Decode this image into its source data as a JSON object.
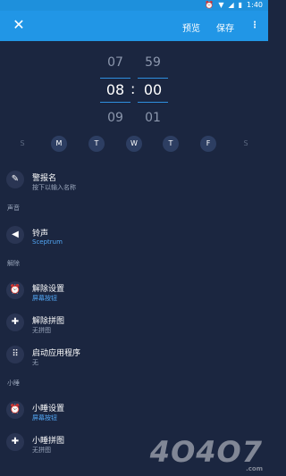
{
  "status": {
    "time": "1:40",
    "icons": [
      "alarm-icon",
      "wifi-icon",
      "signal-icon",
      "battery-icon"
    ]
  },
  "toolbar": {
    "preview": "预览",
    "save": "保存",
    "more": "⋮",
    "close": "✕"
  },
  "picker": {
    "hours": [
      "07",
      "08",
      "09"
    ],
    "minutes": [
      "59",
      "00",
      "01"
    ],
    "colon": ":"
  },
  "days": [
    {
      "label": "S",
      "on": false
    },
    {
      "label": "M",
      "on": true
    },
    {
      "label": "T",
      "on": true
    },
    {
      "label": "W",
      "on": true
    },
    {
      "label": "T",
      "on": true
    },
    {
      "label": "F",
      "on": true
    },
    {
      "label": "S",
      "on": false
    }
  ],
  "items": {
    "label": {
      "title": "警报名",
      "sub": "按下以输入名称"
    },
    "sound_header": "声音",
    "ringtone": {
      "title": "铃声",
      "sub": "Sceptrum"
    },
    "dismiss_header": "解除",
    "dismiss_setting": {
      "title": "解除设置",
      "sub": "屏幕按钮"
    },
    "dismiss_puzzle": {
      "title": "解除拼图",
      "sub": "无拼图"
    },
    "launch_app": {
      "title": "启动应用程序",
      "sub": "无"
    },
    "snooze_header": "小睡",
    "snooze_setting": {
      "title": "小睡设置",
      "sub": "屏幕按钮"
    },
    "snooze_puzzle": {
      "title": "小睡拼图",
      "sub": "无拼图"
    }
  },
  "watermark": {
    "main": "4O4O7",
    "sub": ".com"
  },
  "colors": {
    "toolbar": "#2196e6",
    "background": "#1b2640",
    "accent": "#52a7f5"
  }
}
